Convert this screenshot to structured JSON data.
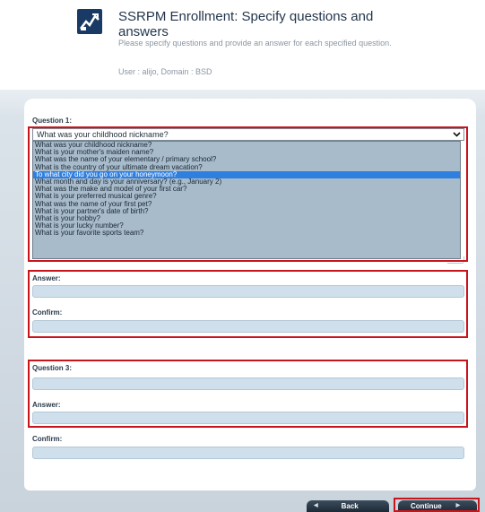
{
  "header": {
    "title": "SSRPM Enrollment: Specify questions and answers",
    "subtitle": "Please specify questions and provide an answer for each specified question.",
    "user_line": "User : alijo, Domain : BSD"
  },
  "question1": {
    "label": "Question 1:",
    "selected": "What was your childhood nickname?",
    "options": [
      "What was your childhood nickname?",
      "What is your mother's maiden name?",
      "What was the name of your elementary / primary school?",
      "What is the country of your ultimate dream vacation?",
      "To what city did you go on your honeymoon?",
      "What month and day is your anniversary? (e.g., January 2)",
      "What was the make and model of your first car?",
      "What is your preferred musical genre?",
      "What was the name of your first pet?",
      "What is your partner's date of birth?",
      "What is your hobby?",
      "What is your lucky number?",
      "What is your favorite sports team?"
    ],
    "highlighted_option": "To what city did you go on your honeymoon?"
  },
  "question2": {
    "answer_label": "Answer:",
    "confirm_label": "Confirm:",
    "answer_value": "",
    "confirm_value": ""
  },
  "question3": {
    "label": "Question 3:",
    "answer_label": "Answer:",
    "confirm_label": "Confirm:",
    "question_value": "",
    "answer_value": "",
    "confirm_value": ""
  },
  "buttons": {
    "back_label": "Back",
    "continue_label": "Continue"
  },
  "colors": {
    "highlight": "#2f7fe0",
    "annotation_red": "#c8151b",
    "field_fill": "#cfe0ec",
    "button_dark": "#1d2935"
  },
  "icons": {
    "logo": "enrollment-logo-icon",
    "dropdown": "chevron-down-icon",
    "back": "arrow-left-icon",
    "continue": "arrow-right-icon"
  }
}
